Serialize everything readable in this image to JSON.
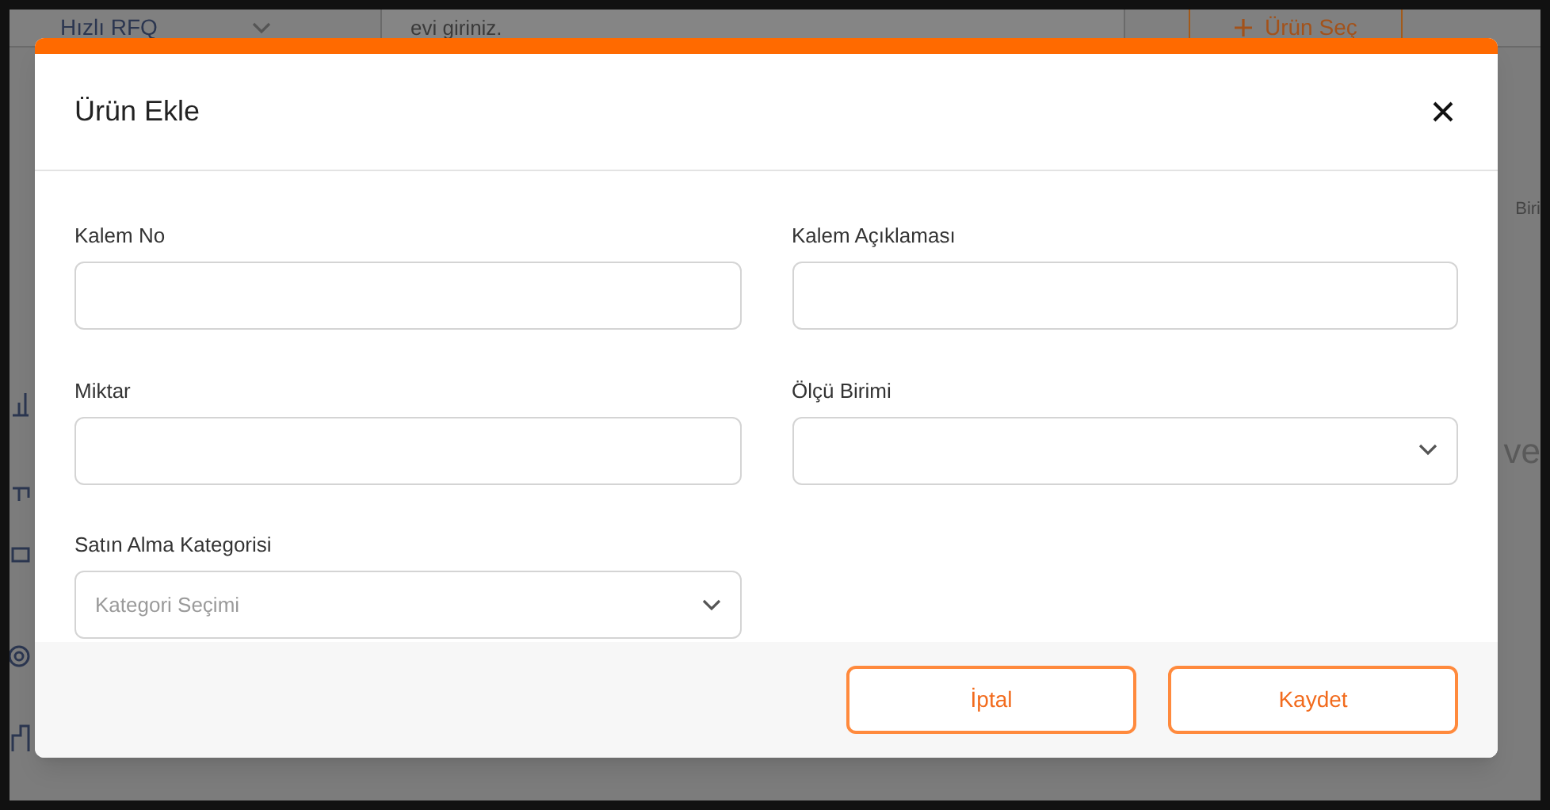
{
  "background": {
    "topbar": {
      "dropdown": "Hızlı RFQ",
      "search_text": "evi giriniz.",
      "button": "Ürün Seç"
    },
    "fragments": [
      "Biri",
      "ve"
    ]
  },
  "dialog": {
    "title": "Ürün Ekle",
    "fields": [
      {
        "kind": "text",
        "label": "Kalem No"
      },
      {
        "kind": "text",
        "label": "Kalem Açıklaması"
      },
      {
        "kind": "text",
        "label": "Miktar"
      },
      {
        "kind": "select",
        "label": "Ölçü Birimi"
      },
      {
        "kind": "select",
        "label": "Satın Alma Kategorisi",
        "placeholder": "Kategori Seçimi"
      }
    ],
    "buttons": [
      "İptal",
      "Kaydet"
    ]
  }
}
